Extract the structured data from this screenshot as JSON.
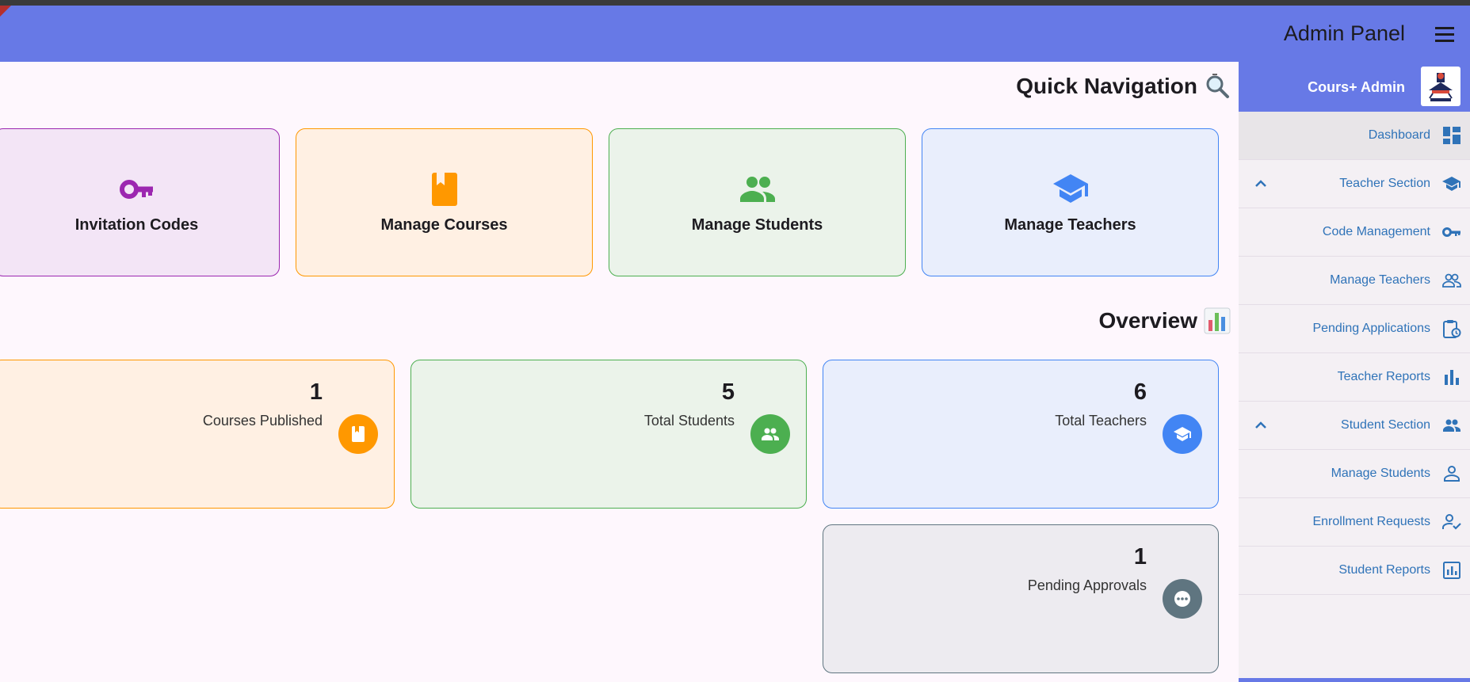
{
  "appbar": {
    "title": "Admin Panel"
  },
  "quick_nav": {
    "title": "Quick Navigation",
    "cards": [
      {
        "label": "Invitation Codes",
        "icon": "key-icon"
      },
      {
        "label": "Manage Courses",
        "icon": "book-icon"
      },
      {
        "label": "Manage Students",
        "icon": "group-icon"
      },
      {
        "label": "Manage Teachers",
        "icon": "school-icon"
      }
    ]
  },
  "overview": {
    "title": "Overview",
    "stats": [
      {
        "value": "1",
        "label": "Courses Published",
        "icon": "book-icon"
      },
      {
        "value": "5",
        "label": "Total Students",
        "icon": "group-icon"
      },
      {
        "value": "6",
        "label": "Total Teachers",
        "icon": "school-icon"
      },
      {
        "value": "1",
        "label": "Pending Approvals",
        "icon": "pending-icon"
      }
    ]
  },
  "drawer": {
    "header": {
      "name": "Cours+ Admin",
      "logo": "Cours+ logo"
    },
    "items": [
      {
        "label": "Dashboard",
        "icon": "dashboard-icon",
        "active": true
      },
      {
        "label": "Teacher Section",
        "icon": "school-icon",
        "expandable": true
      },
      {
        "label": "Code Management",
        "icon": "key-icon"
      },
      {
        "label": "Manage Teachers",
        "icon": "people-outline-icon"
      },
      {
        "label": "Pending Applications",
        "icon": "pending-actions-icon"
      },
      {
        "label": "Teacher Reports",
        "icon": "bar-chart-icon"
      },
      {
        "label": "Student Section",
        "icon": "group-icon",
        "expandable": true
      },
      {
        "label": "Manage Students",
        "icon": "person-outline-icon"
      },
      {
        "label": "Enrollment Requests",
        "icon": "person-check-icon"
      },
      {
        "label": "Student Reports",
        "icon": "analytics-icon"
      }
    ]
  },
  "colors": {
    "appbar": "#6779e6",
    "purple": "#9c27b0",
    "orange": "#ff9800",
    "green": "#4caf50",
    "blue": "#4285f4",
    "slate": "#5f7580",
    "drawer_text": "#2f73b8"
  }
}
